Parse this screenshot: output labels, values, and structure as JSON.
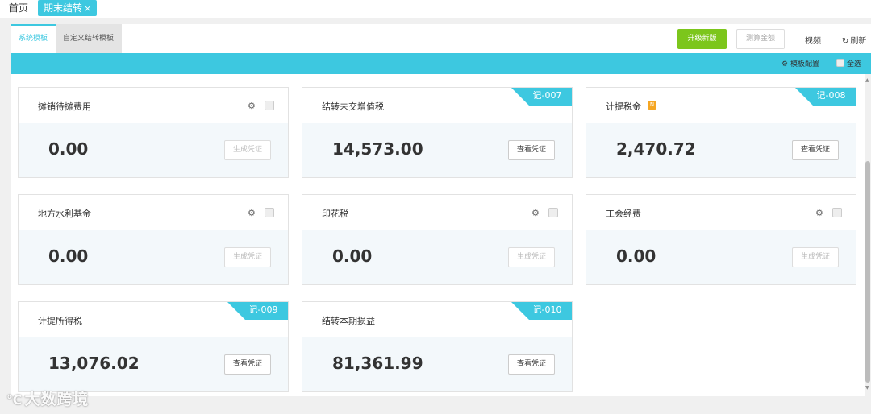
{
  "nav": {
    "home": "首页",
    "active_tab": "期末结转",
    "close": "×"
  },
  "subtabs": {
    "system": "系统模板",
    "custom": "自定义结转模板"
  },
  "toolbar": {
    "upgrade": "升级新版",
    "calc": "测算金额",
    "video": "视频",
    "refresh": "刷新"
  },
  "band": {
    "config": "模板配置",
    "select_all": "全选"
  },
  "colors": {
    "accent": "#3dc8e0",
    "upgrade": "#7cc61c",
    "badge": "#f5a623"
  },
  "cards": [
    {
      "title": "摊销待摊费用",
      "amount": "0.00",
      "button": "生成凭证"
    },
    {
      "title": "结转未交增值税",
      "amount": "14,573.00",
      "button": "查看凭证",
      "tag": "记-007"
    },
    {
      "title": "计提税金",
      "amount": "2,470.72",
      "button": "查看凭证",
      "tag": "记-008",
      "badge": "N"
    },
    {
      "title": "地方水利基金",
      "amount": "0.00",
      "button": "生成凭证"
    },
    {
      "title": "印花税",
      "amount": "0.00",
      "button": "生成凭证"
    },
    {
      "title": "工会经费",
      "amount": "0.00",
      "button": "生成凭证"
    },
    {
      "title": "计提所得税",
      "amount": "13,076.02",
      "button": "查看凭证",
      "tag": "记-009"
    },
    {
      "title": "结转本期损益",
      "amount": "81,361.99",
      "button": "查看凭证",
      "tag": "记-010"
    }
  ],
  "watermark": "大数跨境",
  "icons": {
    "gear": "gear-icon",
    "refresh": "refresh-icon",
    "config": "settings-icon"
  }
}
